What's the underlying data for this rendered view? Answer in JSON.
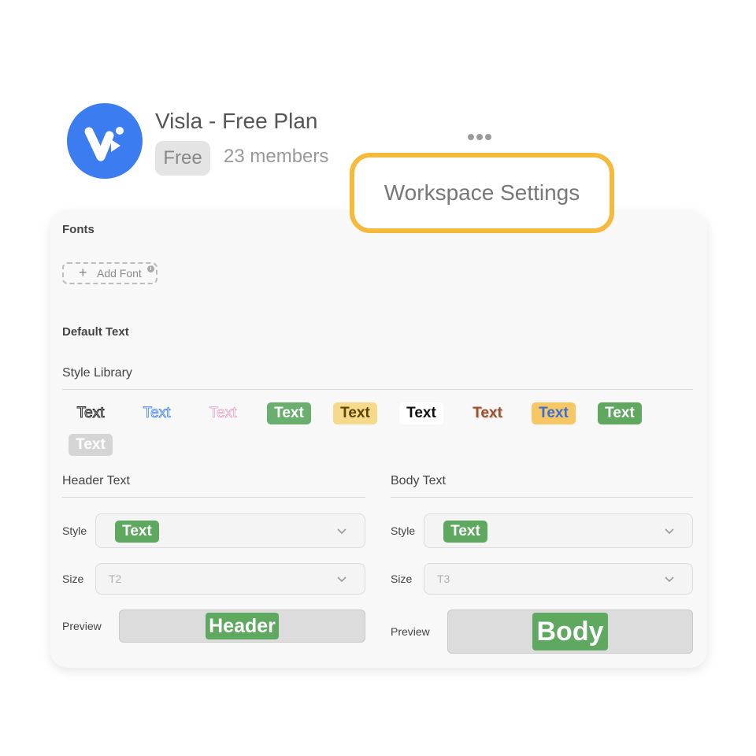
{
  "workspace": {
    "name": "Visla - Free Plan",
    "plan_badge": "Free",
    "members": "23 members",
    "more_icon": "ellipsis-icon",
    "settings_button": "Workspace Settings",
    "brand_color": "#3b7df0",
    "highlight_color": "#f5b93b"
  },
  "fonts": {
    "title": "Fonts",
    "add_font_label": "Add Font",
    "add_icon": "plus-icon",
    "info_icon": "info-icon"
  },
  "default_text": {
    "title": "Default Text",
    "style_library_label": "Style Library",
    "styles": [
      "Text",
      "Text",
      "Text",
      "Text",
      "Text",
      "Text",
      "Text",
      "Text",
      "Text",
      "Text"
    ]
  },
  "header_text": {
    "title": "Header Text",
    "style_label": "Style",
    "style_value": "Text",
    "size_label": "Size",
    "size_value": "T2",
    "preview_label": "Preview",
    "preview_value": "Header"
  },
  "body_text": {
    "title": "Body Text",
    "style_label": "Style",
    "style_value": "Text",
    "size_label": "Size",
    "size_value": "T3",
    "preview_label": "Preview",
    "preview_value": "Body"
  }
}
